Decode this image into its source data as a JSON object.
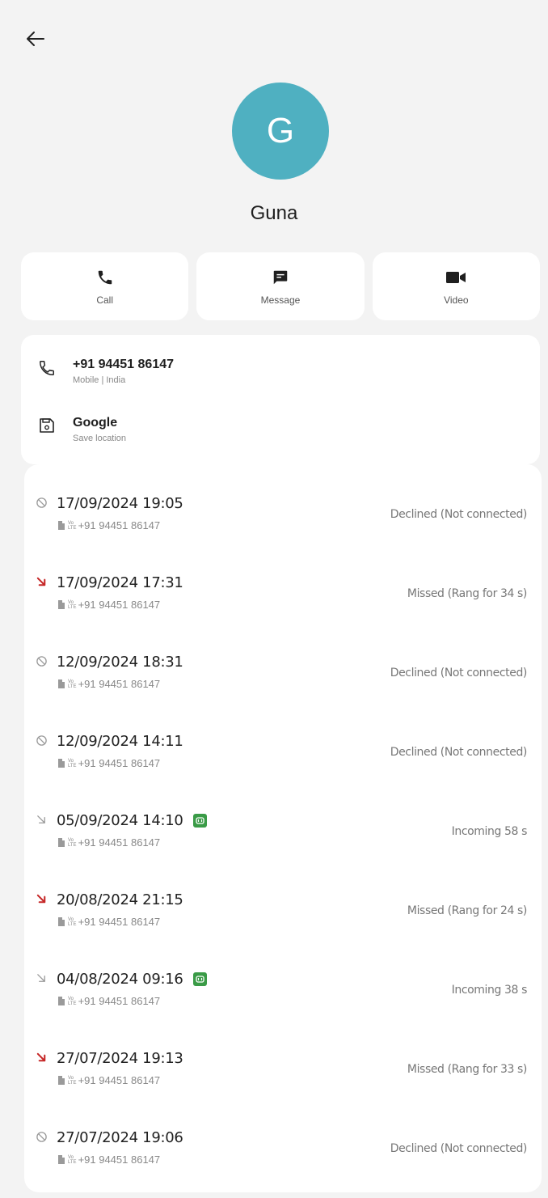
{
  "header": {
    "back_icon": "arrow-left-icon"
  },
  "contact": {
    "initial": "G",
    "name": "Guna",
    "avatar_color": "#4fb0c1"
  },
  "actions": [
    {
      "label": "Call",
      "icon": "phone-icon"
    },
    {
      "label": "Message",
      "icon": "message-icon"
    },
    {
      "label": "Video",
      "icon": "video-icon"
    }
  ],
  "details": {
    "phone": {
      "number": "+91 94451 86147",
      "meta": "Mobile | India",
      "icon": "phone-outline-icon"
    },
    "account": {
      "name": "Google",
      "meta": "Save location",
      "icon": "save-icon"
    }
  },
  "colors": {
    "missed": "#c62828",
    "neutral_icon": "#9a9a9a",
    "hd_badge": "#3a9b47"
  },
  "call_history": [
    {
      "type": "declined",
      "datetime": "17/09/2024 19:05",
      "sim": "1",
      "volte": "Vo LTE",
      "number": "+91 94451 86147",
      "status": "Declined (Not connected)",
      "hd": false
    },
    {
      "type": "missed",
      "datetime": "17/09/2024 17:31",
      "sim": "1",
      "volte": "Vo LTE",
      "number": "+91 94451 86147",
      "status": "Missed (Rang for 34 s)",
      "hd": false
    },
    {
      "type": "declined",
      "datetime": "12/09/2024 18:31",
      "sim": "1",
      "volte": "Vo LTE",
      "number": "+91 94451 86147",
      "status": "Declined (Not connected)",
      "hd": false
    },
    {
      "type": "declined",
      "datetime": "12/09/2024 14:11",
      "sim": "1",
      "volte": "Vo LTE",
      "number": "+91 94451 86147",
      "status": "Declined (Not connected)",
      "hd": false
    },
    {
      "type": "incoming",
      "datetime": "05/09/2024 14:10",
      "sim": "1",
      "volte": "Vo LTE",
      "number": "+91 94451 86147",
      "status": "Incoming  58 s",
      "hd": true
    },
    {
      "type": "missed",
      "datetime": "20/08/2024 21:15",
      "sim": "1",
      "volte": "Vo LTE",
      "number": "+91 94451 86147",
      "status": "Missed (Rang for 24 s)",
      "hd": false
    },
    {
      "type": "incoming",
      "datetime": "04/08/2024 09:16",
      "sim": "1",
      "volte": "Vo LTE",
      "number": "+91 94451 86147",
      "status": "Incoming  38 s",
      "hd": true
    },
    {
      "type": "missed",
      "datetime": "27/07/2024 19:13",
      "sim": "1",
      "volte": "Vo LTE",
      "number": "+91 94451 86147",
      "status": "Missed (Rang for 33 s)",
      "hd": false
    },
    {
      "type": "declined",
      "datetime": "27/07/2024 19:06",
      "sim": "1",
      "volte": "Vo LTE",
      "number": "+91 94451 86147",
      "status": "Declined (Not connected)",
      "hd": false
    }
  ]
}
